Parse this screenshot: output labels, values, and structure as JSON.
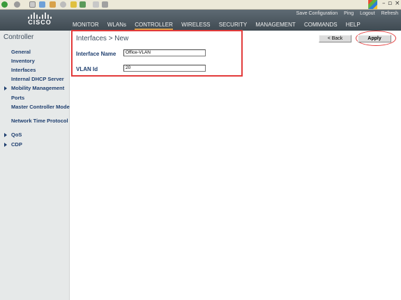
{
  "browser": {
    "window_controls": {
      "minimize": "–",
      "maximize": "▫",
      "close": "×"
    }
  },
  "header": {
    "logo_text": "CISCO",
    "top_links": [
      "Save Configuration",
      "Ping",
      "Logout",
      "Refresh"
    ],
    "nav": [
      "MONITOR",
      "WLANs",
      "CONTROLLER",
      "WIRELESS",
      "SECURITY",
      "MANAGEMENT",
      "COMMANDS",
      "HELP"
    ],
    "active_nav": "CONTROLLER"
  },
  "sidebar": {
    "title": "Controller",
    "items": [
      {
        "label": "General",
        "expandable": false
      },
      {
        "label": "Inventory",
        "expandable": false
      },
      {
        "label": "Interfaces",
        "expandable": false
      },
      {
        "label": "Internal DHCP Server",
        "expandable": false
      },
      {
        "label": "Mobility Management",
        "expandable": true
      },
      {
        "label": "Ports",
        "expandable": false
      },
      {
        "label": "Master Controller Mode",
        "expandable": false
      },
      {
        "label": "Network Time Protocol",
        "expandable": false
      },
      {
        "label": "QoS",
        "expandable": true
      },
      {
        "label": "CDP",
        "expandable": true
      }
    ]
  },
  "main": {
    "title": "Interfaces > New",
    "fields": [
      {
        "label": "Interface Name",
        "value": "Office-VLAN"
      },
      {
        "label": "VLAN Id",
        "value": "20"
      }
    ],
    "buttons": {
      "back": "< Back",
      "apply": "Apply"
    }
  },
  "colors": {
    "header_bg": "#4a555d",
    "highlight_red": "#e23a3a",
    "nav_active_underline": "#d8a046",
    "label_blue": "#1f3f6f"
  }
}
